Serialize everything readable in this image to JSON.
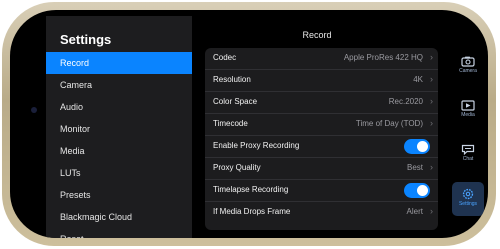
{
  "sidebar": {
    "title": "Settings",
    "items": [
      {
        "label": "Record"
      },
      {
        "label": "Camera"
      },
      {
        "label": "Audio"
      },
      {
        "label": "Monitor"
      },
      {
        "label": "Media"
      },
      {
        "label": "LUTs"
      },
      {
        "label": "Presets"
      },
      {
        "label": "Blackmagic Cloud"
      },
      {
        "label": "Reset"
      }
    ]
  },
  "panel": {
    "title": "Record",
    "rows": [
      {
        "label": "Codec",
        "value": "Apple ProRes 422 HQ"
      },
      {
        "label": "Resolution",
        "value": "4K"
      },
      {
        "label": "Color Space",
        "value": "Rec.2020"
      },
      {
        "label": "Timecode",
        "value": "Time of Day (TOD)"
      },
      {
        "label": "Enable Proxy Recording",
        "toggle": true
      },
      {
        "label": "Proxy Quality",
        "value": "Best"
      },
      {
        "label": "Timelapse Recording",
        "toggle": true
      },
      {
        "label": "If Media Drops Frame",
        "value": "Alert"
      }
    ]
  },
  "tabs": [
    {
      "label": "Camera",
      "icon": "camera-icon"
    },
    {
      "label": "Media",
      "icon": "media-icon"
    },
    {
      "label": "Chat",
      "icon": "chat-icon"
    },
    {
      "label": "Settings",
      "icon": "gear-icon",
      "active": true
    }
  ],
  "colors": {
    "accent": "#0a84ff",
    "bezel": "#cdbf9c"
  }
}
